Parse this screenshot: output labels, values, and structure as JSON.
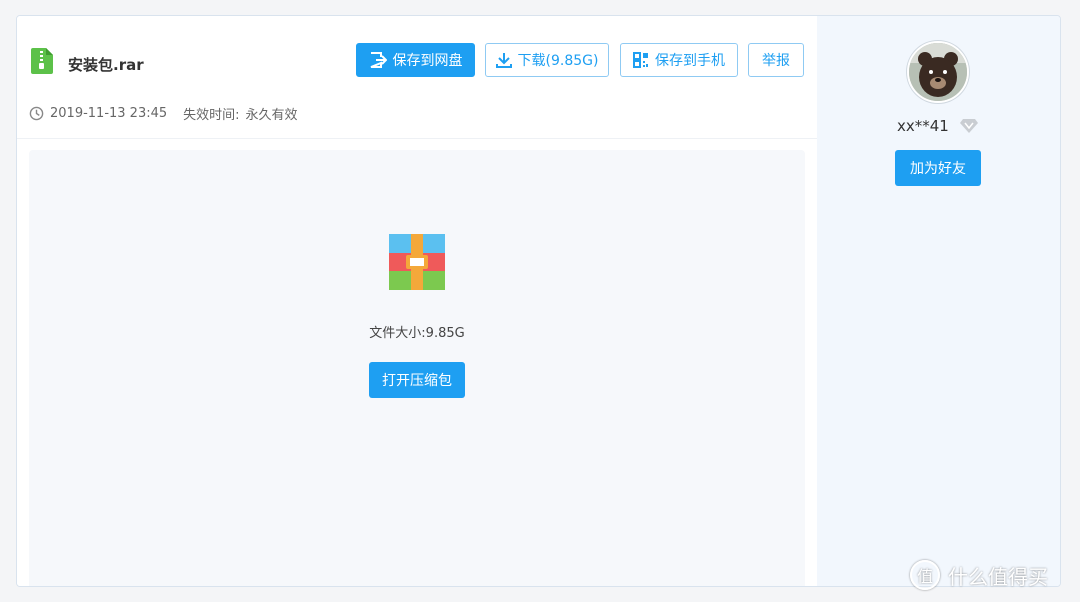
{
  "file": {
    "name": "安装包.rar",
    "date": "2019-11-13 23:45",
    "expire_label": "失效时间:",
    "expire_value": "永久有效",
    "size_text": "文件大小:9.85G"
  },
  "toolbar": {
    "save_cloud": "保存到网盘",
    "download": "下载(9.85G)",
    "save_phone": "保存到手机",
    "report": "举报"
  },
  "preview": {
    "open_label": "打开压缩包"
  },
  "user": {
    "name": "xx**41",
    "add_friend": "加为好友"
  },
  "watermark": {
    "text": "什么值得买",
    "symbol": "值"
  },
  "colors": {
    "accent": "#1e9ff2",
    "sidebar_bg": "#f2f7fd",
    "preview_bg": "#f6f8fb"
  },
  "icons": [
    "zip-file-icon",
    "save-cloud-icon",
    "download-icon",
    "qr-code-icon",
    "clock-icon",
    "rar-archive-icon",
    "diamond-icon"
  ]
}
